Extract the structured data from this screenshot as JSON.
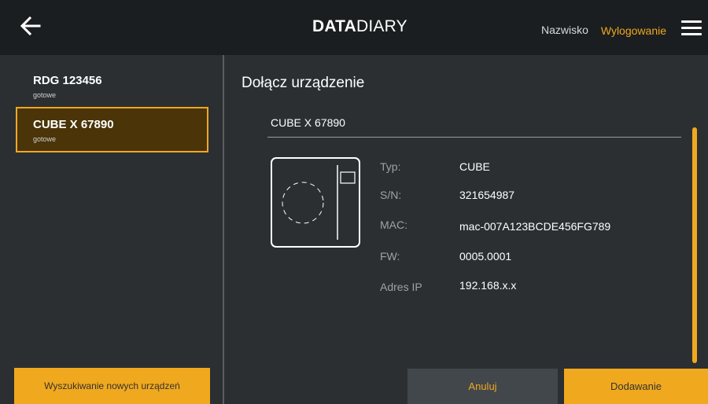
{
  "header": {
    "back_icon": "arrow-left-icon",
    "logo_bold": "DATA",
    "logo_light": "DIARY",
    "user_name": "Nazwisko",
    "logout_label": "Wylogowanie",
    "menu_icon": "hamburger-menu-icon"
  },
  "sidebar": {
    "devices": [
      {
        "name": "RDG 123456",
        "status": "gotowe",
        "selected": false
      },
      {
        "name": "CUBE X 67890",
        "status": "gotowe",
        "selected": true
      }
    ],
    "scan_button_label": "Wyszukiwanie nowych urządzeń"
  },
  "main": {
    "title": "Dołącz urządzenie",
    "device_name": "CUBE X 67890",
    "device_icon": "cube-device-icon",
    "details": {
      "type_label": "Typ:",
      "type_value": "CUBE",
      "sn_label": "S/N:",
      "sn_value": "321654987",
      "mac_label": "MAC:",
      "mac_value": "mac-007A123BCDE456FG789",
      "fw_label": "FW:",
      "fw_value": "0005.0001",
      "ip_label": "Adres IP",
      "ip_value": "192.168.x.x"
    }
  },
  "actions": {
    "cancel_label": "Anuluj",
    "add_label": "Dodawanie"
  },
  "colors": {
    "accent": "#f0a81e",
    "background": "#2b2f32",
    "topbar": "#1b1e20",
    "selected_bg": "#4a3408"
  }
}
